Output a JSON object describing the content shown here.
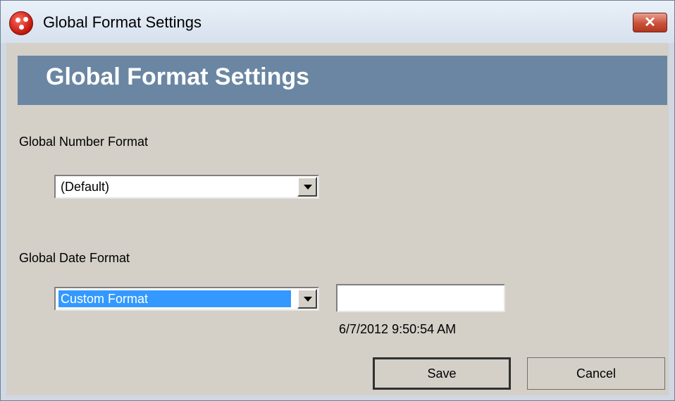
{
  "window": {
    "title": "Global Format Settings",
    "close_glyph": "✕"
  },
  "banner": {
    "title": "Global Format Settings"
  },
  "number_format": {
    "label": "Global Number Format",
    "selected": "(Default)"
  },
  "date_format": {
    "label": "Global Date Format",
    "selected": "Custom Format",
    "custom_value": "",
    "preview": "6/7/2012 9:50:54 AM"
  },
  "buttons": {
    "save": "Save",
    "cancel": "Cancel"
  },
  "colors": {
    "banner": "#6a86a2",
    "selection": "#3399ff",
    "close": "#c9503a"
  }
}
